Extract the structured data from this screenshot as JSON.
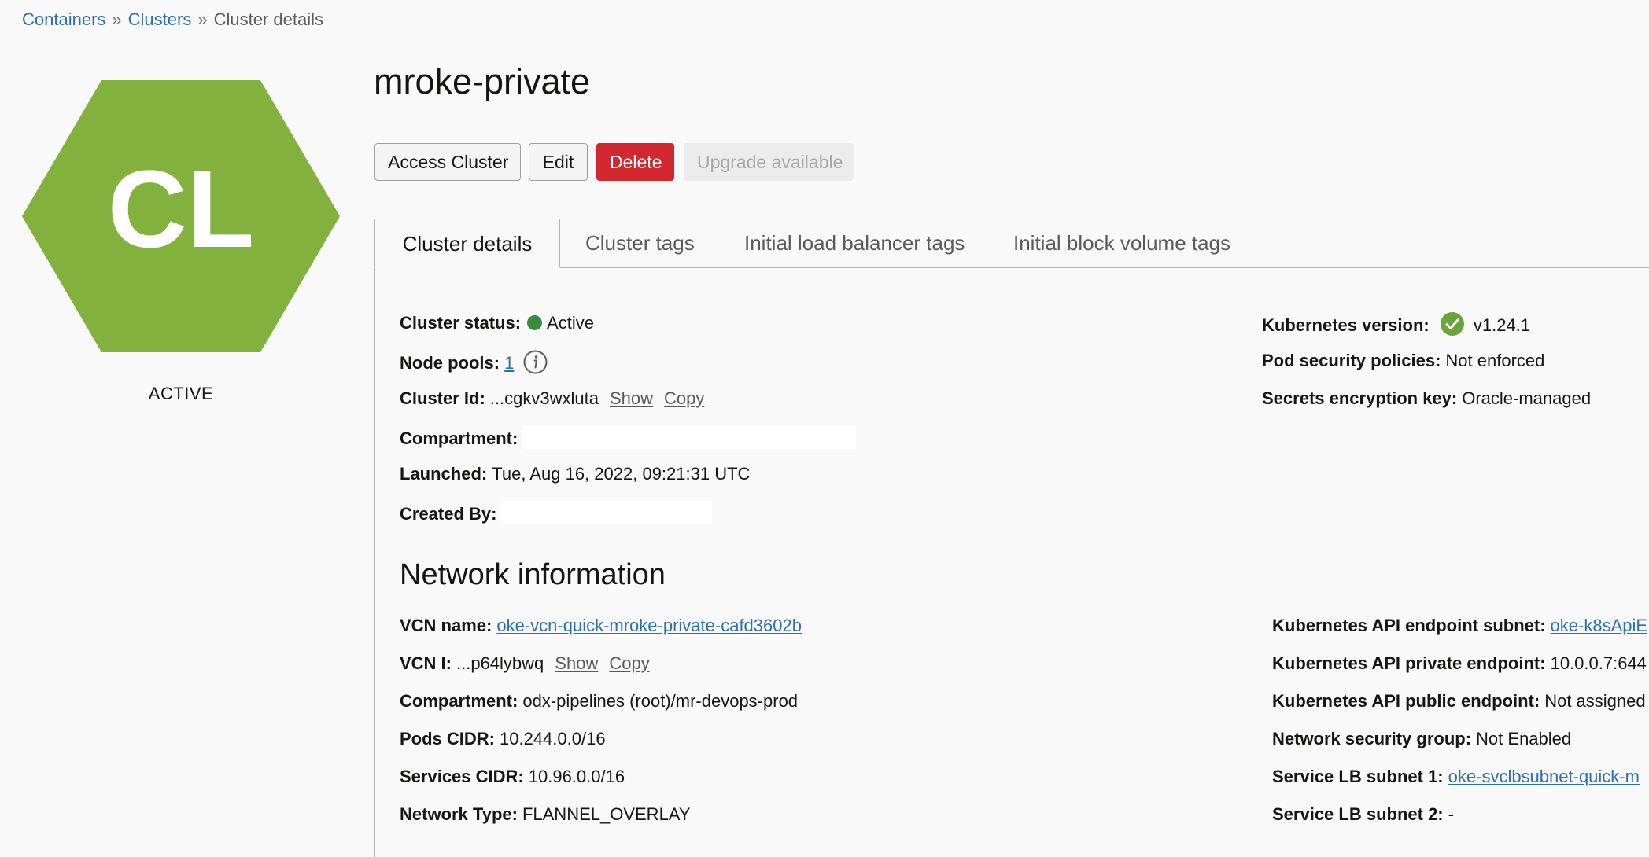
{
  "breadcrumb": {
    "items": [
      "Containers",
      "Clusters",
      "Cluster details"
    ],
    "separator": "»"
  },
  "hex": {
    "initials": "CL",
    "status": "ACTIVE",
    "color": "#82b13d"
  },
  "title": "mroke-private",
  "buttons": {
    "access": "Access Cluster",
    "edit": "Edit",
    "delete": "Delete",
    "upgrade": "Upgrade available"
  },
  "tabs": [
    {
      "label": "Cluster details",
      "active": true
    },
    {
      "label": "Cluster tags",
      "active": false
    },
    {
      "label": "Initial load balancer tags",
      "active": false
    },
    {
      "label": "Initial block volume tags",
      "active": false
    }
  ],
  "cluster": {
    "status_label": "Cluster status:",
    "status_value": "Active",
    "node_pools_label": "Node pools:",
    "node_pools_value": "1",
    "id_label": "Cluster Id:",
    "id_value": "...cgkv3wxluta",
    "show": "Show",
    "copy": "Copy",
    "compartment_label": "Compartment:",
    "launched_label": "Launched:",
    "launched_value": "Tue, Aug 16, 2022, 09:21:31 UTC",
    "created_by_label": "Created By:",
    "k8s_version_label": "Kubernetes version:",
    "k8s_version_value": "v1.24.1",
    "pod_security_label": "Pod security policies:",
    "pod_security_value": "Not enforced",
    "secrets_label": "Secrets encryption key:",
    "secrets_value": "Oracle-managed"
  },
  "network": {
    "title": "Network information",
    "vcn_name_label": "VCN name:",
    "vcn_name_value": "oke-vcn-quick-mroke-private-cafd3602b",
    "vcn_id_label": "VCN I:",
    "vcn_id_value": "...p64lybwq",
    "show": "Show",
    "copy": "Copy",
    "compartment_label": "Compartment:",
    "compartment_value": "odx-pipelines (root)/mr-devops-prod",
    "pods_cidr_label": "Pods CIDR:",
    "pods_cidr_value": "10.244.0.0/16",
    "services_cidr_label": "Services CIDR:",
    "services_cidr_value": "10.96.0.0/16",
    "network_type_label": "Network Type:",
    "network_type_value": "FLANNEL_OVERLAY",
    "api_subnet_label": "Kubernetes API endpoint subnet:",
    "api_subnet_value": "oke-k8sApiE",
    "api_private_label": "Kubernetes API private endpoint:",
    "api_private_value": "10.0.0.7:644",
    "api_public_label": "Kubernetes API public endpoint:",
    "api_public_value": "Not assigned",
    "nsg_label": "Network security group:",
    "nsg_value": "Not Enabled",
    "lb_subnet1_label": "Service LB subnet 1:",
    "lb_subnet1_value": "oke-svclbsubnet-quick-m",
    "lb_subnet2_label": "Service LB subnet 2:",
    "lb_subnet2_value": "-"
  },
  "colors": {
    "link": "#2a6ebb",
    "delete": "#d3282f",
    "status_dot": "#3b8a3e",
    "check": "#6aa53a"
  }
}
